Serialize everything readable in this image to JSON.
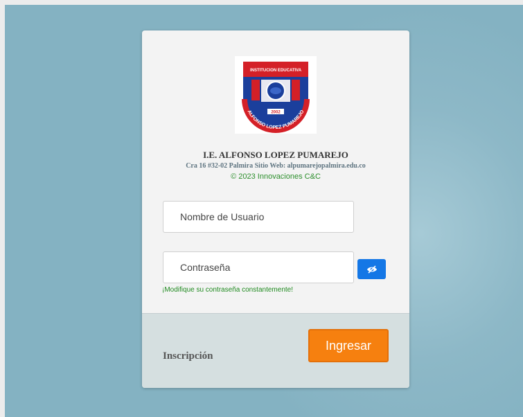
{
  "institution": {
    "logo_top_text": "INSTITUCION EDUCATIVA",
    "logo_year": "2002",
    "logo_bottom_text": "ALFONSO LOPEZ PUMAREJO",
    "name": "I.E. ALFONSO LOPEZ PUMAREJO",
    "address": "Cra 16 #32-02 Palmira Sitio Web: alpumarejopalmira.edu.co",
    "copyright": "© 2023 Innovaciones C&C"
  },
  "login": {
    "username_placeholder": "Nombre de Usuario",
    "password_placeholder": "Contraseña",
    "password_hint": "¡Modifique su contraseña constantemente!",
    "toggle_icon": "eye-slash-icon",
    "signup_label": "Inscripción",
    "submit_label": "Ingresar"
  },
  "colors": {
    "background": "#8db8c7",
    "submit": "#f6800f",
    "toggle": "#1477e6",
    "hint": "#1f8a1f"
  }
}
